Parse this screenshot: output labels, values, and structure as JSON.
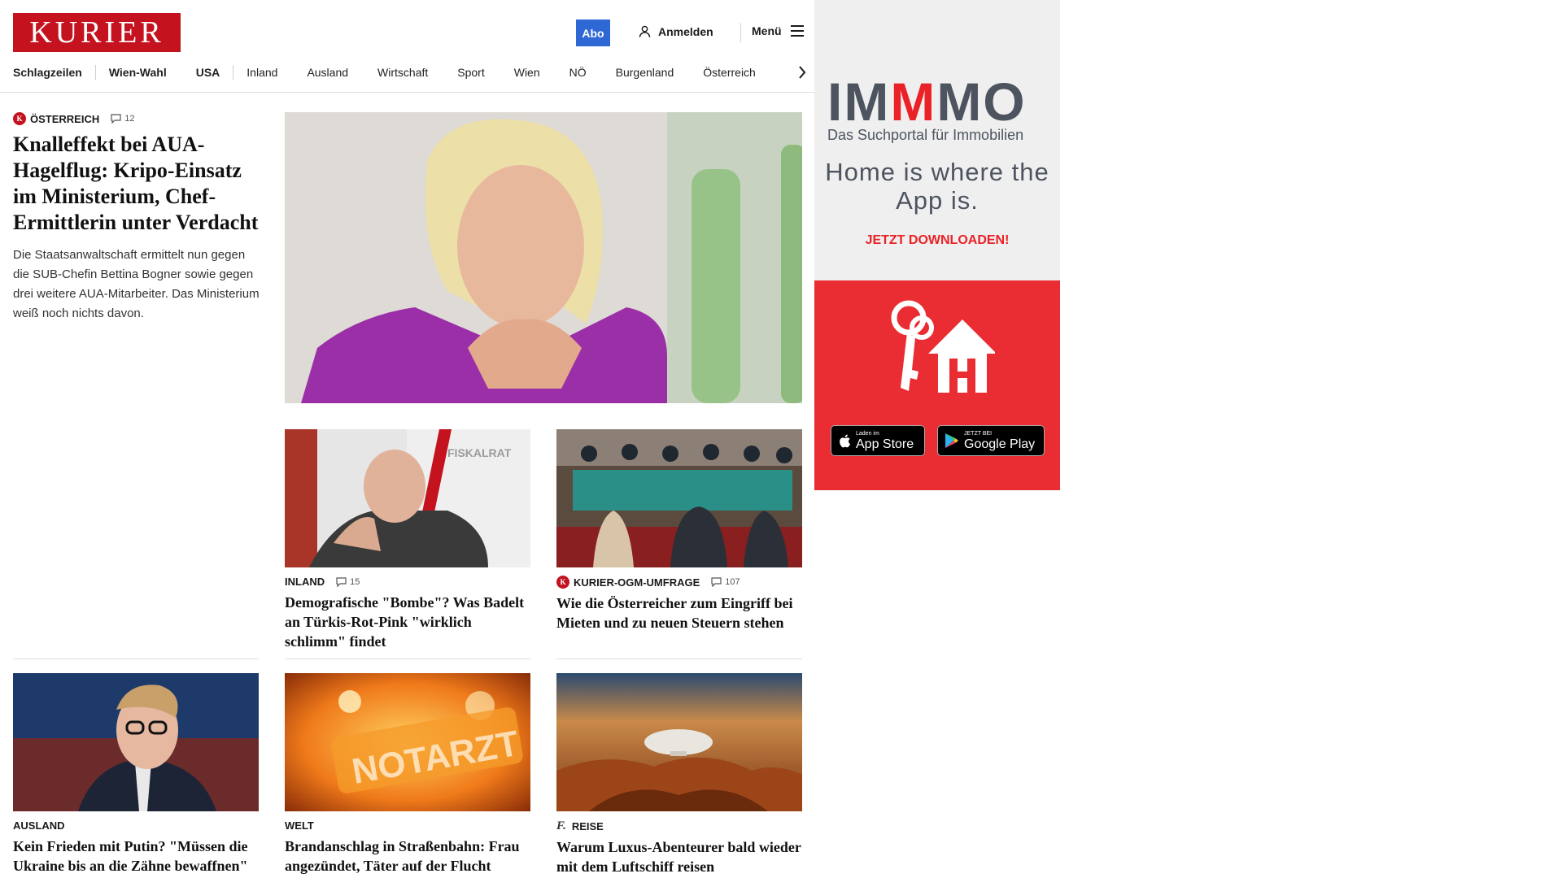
{
  "header": {
    "logo_text": "KURIER",
    "abo_label": "Abo",
    "login_label": "Anmelden",
    "menu_label": "Menü"
  },
  "nav": {
    "items": [
      "Schlagzeilen",
      "Wien-Wahl",
      "USA",
      "Inland",
      "Ausland",
      "Wirtschaft",
      "Sport",
      "Wien",
      "NÖ",
      "Burgenland",
      "Österreich"
    ]
  },
  "lead": {
    "category": "ÖSTERREICH",
    "comments": "12",
    "title": "Knalleffekt bei AUA-Hagelflug: Kripo-Einsatz im Ministerium, Chef-Ermittlerin unter Verdacht",
    "teaser": "Die Staatsanwaltschaft ermittelt nun gegen die SUB-Chefin Bettina Bogner sowie gegen drei weitere AUA-Mitarbeiter. Das Ministerium weiß noch nichts davon."
  },
  "cards": [
    {
      "category": "INLAND",
      "comments": "15",
      "title": "Demografische \"Bombe\"? Was Badelt an Türkis-Rot-Pink \"wirklich schlimm\" findet",
      "image_text": "FISKALRAT"
    },
    {
      "category": "KURIER-OGM-UMFRAGE",
      "comments": "107",
      "title": "Wie die Österreicher zum Eingriff bei Mieten und zu neuen Steuern stehen"
    },
    {
      "category": "AUSLAND",
      "title": "Kein Frieden mit Putin? \"Müssen die Ukraine bis an die Zähne bewaffnen\""
    },
    {
      "category": "WELT",
      "title": "Brandanschlag in Straßenbahn: Frau angezündet, Täter auf der Flucht",
      "image_text": "NOTARZT"
    },
    {
      "category": "REISE",
      "title": "Warum Luxus-Abenteurer bald wieder mit dem Luftschiff reisen"
    }
  ],
  "ad": {
    "brand_1": "IM",
    "brand_2": "M",
    "brand_3": "MO",
    "subtitle": "Das Suchportal für Immobilien",
    "slogan": "Home is where the App is.",
    "cta": "JETZT DOWNLOADEN!",
    "appstore_small": "Laden im",
    "appstore_big": "App Store",
    "googleplay_small": "JETZT BEI",
    "googleplay_big": "Google Play"
  },
  "colors": {
    "brand_red": "#c4121f",
    "abo_blue": "#2e68d4",
    "ad_red": "#ea2c33"
  }
}
